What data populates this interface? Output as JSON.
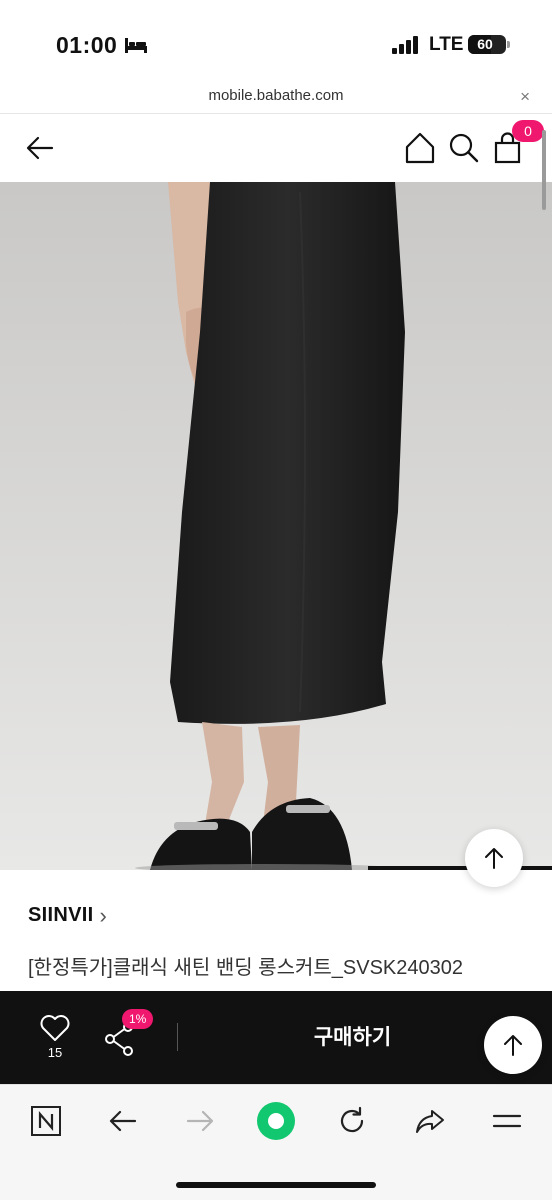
{
  "status_bar": {
    "time": "01:00",
    "network": "LTE",
    "battery_level": "60"
  },
  "browser": {
    "url": "mobile.babathe.com",
    "close_label": "×"
  },
  "header": {
    "cart_count": "0"
  },
  "product": {
    "image_progress": 0.333,
    "brand": "SIINVII",
    "brand_chevron": "›",
    "name": "[한정특가]클래식 새틴 밴딩 롱스커트_SVSK240302"
  },
  "purchase_bar": {
    "like_count": "15",
    "share_badge": "1%",
    "buy_label": "구매하기"
  },
  "icons": [
    "bed-icon",
    "signal-icon",
    "back-arrow-icon",
    "home-icon",
    "search-icon",
    "cart-icon",
    "scroll-top-icon",
    "heart-icon",
    "share-icon",
    "naver-icon",
    "browser-back-icon",
    "browser-forward-icon",
    "green-dot-icon",
    "refresh-icon",
    "browser-share-icon",
    "menu-icon"
  ],
  "colors": {
    "accent": "#f0176e",
    "bar_bg": "#111111",
    "green_dot": "#11c76f"
  }
}
